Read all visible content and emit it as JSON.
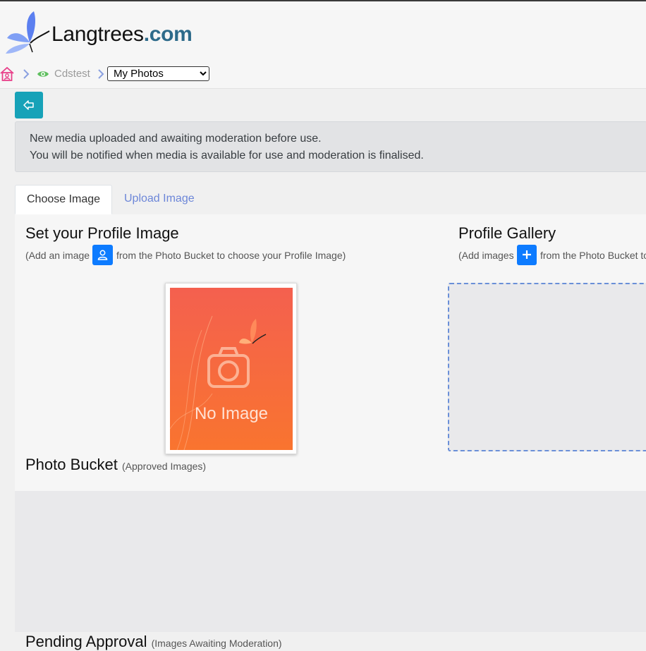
{
  "header": {
    "brand_name": "Langtrees",
    "brand_tld": ".com"
  },
  "breadcrumb": {
    "current_user": "Cdstest",
    "section_select": {
      "value": "My Photos",
      "options": [
        "My Photos"
      ]
    }
  },
  "alert": {
    "line1": "New media uploaded and awaiting moderation before use.",
    "line2": "You will be notified when media is available for use and moderation is finalised."
  },
  "tabs": [
    {
      "label": "Choose Image",
      "active": true
    },
    {
      "label": "Upload Image",
      "active": false
    }
  ],
  "profile_image": {
    "title": "Set your Profile Image",
    "hint_before": "(Add an image",
    "hint_after": "from the Photo Bucket to choose your Profile Image)",
    "placeholder_text": "No Image"
  },
  "profile_gallery": {
    "title": "Profile Gallery",
    "hint_before": "(Add images",
    "hint_after": "from the Photo Bucket to"
  },
  "photo_bucket": {
    "title": "Photo Bucket",
    "subtitle": "(Approved Images)"
  },
  "pending_approval": {
    "title": "Pending Approval",
    "subtitle": "(Images Awaiting Moderation)"
  },
  "icons": {
    "logo": "butterfly-logo-icon",
    "home": "home-icon",
    "chevron": "chevron-right-icon",
    "eye": "eye-icon",
    "back": "arrow-left-icon",
    "user": "user-icon",
    "plus": "plus-icon",
    "camera": "camera-icon"
  },
  "colors": {
    "brand_tld": "#2d6a8a",
    "back_button": "#17a2b8",
    "action_button": "#0d7bff",
    "tab_link": "#6c86d8",
    "home_icon": "#e8408a",
    "eye_icon": "#5fbf5f",
    "chevron": "#8aa0e0",
    "dashed_border": "#6a8fd8"
  }
}
